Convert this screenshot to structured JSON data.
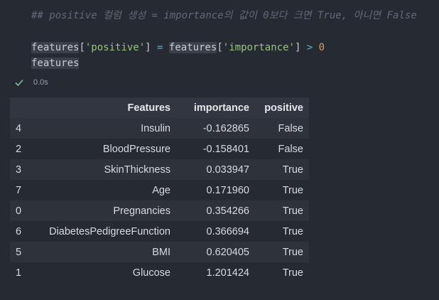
{
  "code": {
    "comment": "## positive 컬럼 생성 = importance의 값이 0보다 크면 True, 아니면 False",
    "assign": {
      "var1": "features",
      "bracket_open": "[",
      "key1": "'positive'",
      "bracket_close": "]",
      "eq": " = ",
      "var2": "features",
      "key2": "'importance'",
      "gt": " > ",
      "zero": "0"
    },
    "display_var": "features"
  },
  "status": {
    "icon": "check-icon",
    "duration": "0.0s",
    "color": "#73c991"
  },
  "table": {
    "columns": [
      "",
      "Features",
      "importance",
      "positive"
    ],
    "rows": [
      {
        "index": "4",
        "feature": "Insulin",
        "importance": "-0.162865",
        "positive": "False"
      },
      {
        "index": "2",
        "feature": "BloodPressure",
        "importance": "-0.158401",
        "positive": "False"
      },
      {
        "index": "3",
        "feature": "SkinThickness",
        "importance": "0.033947",
        "positive": "True"
      },
      {
        "index": "7",
        "feature": "Age",
        "importance": "0.171960",
        "positive": "True"
      },
      {
        "index": "0",
        "feature": "Pregnancies",
        "importance": "0.354266",
        "positive": "True"
      },
      {
        "index": "6",
        "feature": "DiabetesPedigreeFunction",
        "importance": "0.366694",
        "positive": "True"
      },
      {
        "index": "5",
        "feature": "BMI",
        "importance": "0.620405",
        "positive": "True"
      },
      {
        "index": "1",
        "feature": "Glucose",
        "importance": "1.201424",
        "positive": "True"
      }
    ]
  }
}
